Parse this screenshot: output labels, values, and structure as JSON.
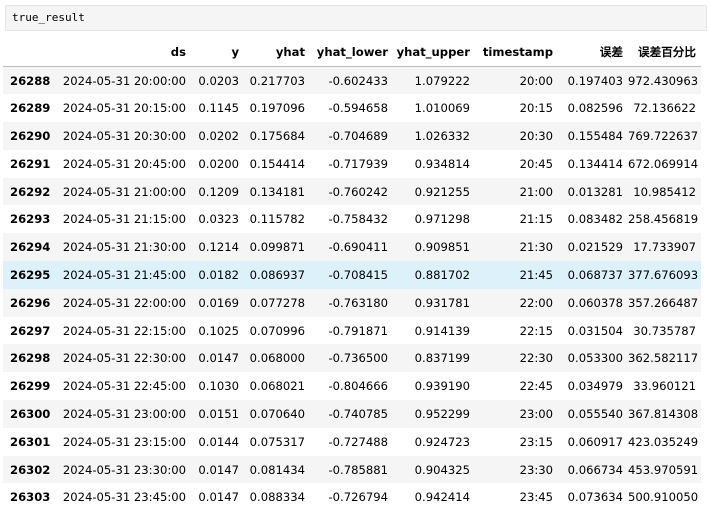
{
  "code_cell": {
    "text": "true_result"
  },
  "table": {
    "index_header": "",
    "columns": [
      "ds",
      "y",
      "yhat",
      "yhat_lower",
      "yhat_upper",
      "timestamp",
      "误差",
      "误差百分比"
    ],
    "highlighted_row_index": 7,
    "rows": [
      {
        "index": "26288",
        "cells": [
          "2024-05-31 20:00:00",
          "0.0203",
          "0.217703",
          "-0.602433",
          "1.079222",
          "20:00",
          "0.197403",
          "972.430963"
        ]
      },
      {
        "index": "26289",
        "cells": [
          "2024-05-31 20:15:00",
          "0.1145",
          "0.197096",
          "-0.594658",
          "1.010069",
          "20:15",
          "0.082596",
          "72.136622"
        ]
      },
      {
        "index": "26290",
        "cells": [
          "2024-05-31 20:30:00",
          "0.0202",
          "0.175684",
          "-0.704689",
          "1.026332",
          "20:30",
          "0.155484",
          "769.722637"
        ]
      },
      {
        "index": "26291",
        "cells": [
          "2024-05-31 20:45:00",
          "0.0200",
          "0.154414",
          "-0.717939",
          "0.934814",
          "20:45",
          "0.134414",
          "672.069914"
        ]
      },
      {
        "index": "26292",
        "cells": [
          "2024-05-31 21:00:00",
          "0.1209",
          "0.134181",
          "-0.760242",
          "0.921255",
          "21:00",
          "0.013281",
          "10.985412"
        ]
      },
      {
        "index": "26293",
        "cells": [
          "2024-05-31 21:15:00",
          "0.0323",
          "0.115782",
          "-0.758432",
          "0.971298",
          "21:15",
          "0.083482",
          "258.456819"
        ]
      },
      {
        "index": "26294",
        "cells": [
          "2024-05-31 21:30:00",
          "0.1214",
          "0.099871",
          "-0.690411",
          "0.909851",
          "21:30",
          "0.021529",
          "17.733907"
        ]
      },
      {
        "index": "26295",
        "cells": [
          "2024-05-31 21:45:00",
          "0.0182",
          "0.086937",
          "-0.708415",
          "0.881702",
          "21:45",
          "0.068737",
          "377.676093"
        ]
      },
      {
        "index": "26296",
        "cells": [
          "2024-05-31 22:00:00",
          "0.0169",
          "0.077278",
          "-0.763180",
          "0.931781",
          "22:00",
          "0.060378",
          "357.266487"
        ]
      },
      {
        "index": "26297",
        "cells": [
          "2024-05-31 22:15:00",
          "0.1025",
          "0.070996",
          "-0.791871",
          "0.914139",
          "22:15",
          "0.031504",
          "30.735787"
        ]
      },
      {
        "index": "26298",
        "cells": [
          "2024-05-31 22:30:00",
          "0.0147",
          "0.068000",
          "-0.736500",
          "0.837199",
          "22:30",
          "0.053300",
          "362.582117"
        ]
      },
      {
        "index": "26299",
        "cells": [
          "2024-05-31 22:45:00",
          "0.1030",
          "0.068021",
          "-0.804666",
          "0.939190",
          "22:45",
          "0.034979",
          "33.960121"
        ]
      },
      {
        "index": "26300",
        "cells": [
          "2024-05-31 23:00:00",
          "0.0151",
          "0.070640",
          "-0.740785",
          "0.952299",
          "23:00",
          "0.055540",
          "367.814308"
        ]
      },
      {
        "index": "26301",
        "cells": [
          "2024-05-31 23:15:00",
          "0.0144",
          "0.075317",
          "-0.727488",
          "0.924723",
          "23:15",
          "0.060917",
          "423.035249"
        ]
      },
      {
        "index": "26302",
        "cells": [
          "2024-05-31 23:30:00",
          "0.0147",
          "0.081434",
          "-0.785881",
          "0.904325",
          "23:30",
          "0.066734",
          "453.970591"
        ]
      },
      {
        "index": "26303",
        "cells": [
          "2024-05-31 23:45:00",
          "0.0147",
          "0.088334",
          "-0.726794",
          "0.942414",
          "23:45",
          "0.073634",
          "500.910050"
        ]
      }
    ]
  }
}
